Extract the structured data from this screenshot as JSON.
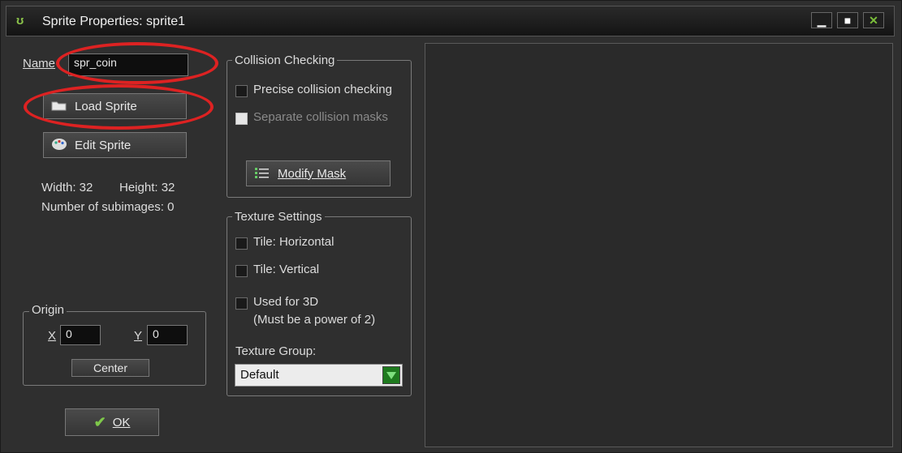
{
  "window": {
    "title": "Sprite Properties: sprite1",
    "app_icon_glyph": "ʊ"
  },
  "controls": {
    "minimize": "▁",
    "maximize": "■",
    "close": "✕"
  },
  "left": {
    "name_label": "Name",
    "name_value": "spr_coin",
    "load_sprite": "Load Sprite",
    "edit_sprite": "Edit Sprite",
    "width_text": "Width: 32",
    "height_text": "Height: 32",
    "subimages_text": "Number of subimages: 0",
    "origin_group": "Origin",
    "x_label": "X",
    "x_value": "0",
    "y_label": "Y",
    "y_value": "0",
    "center_button": "Center",
    "ok_button": "OK"
  },
  "collision": {
    "group": "Collision Checking",
    "precise": "Precise collision checking",
    "separate_masks": "Separate collision masks",
    "modify_mask": "Modify Mask"
  },
  "texture": {
    "group": "Texture Settings",
    "tile_h": "Tile: Horizontal",
    "tile_v": "Tile: Vertical",
    "used_3d_line1": "Used for 3D",
    "used_3d_line2": "(Must be a power of 2)",
    "group_label": "Texture Group:",
    "group_value": "Default"
  },
  "colors": {
    "annotation": "#d22222",
    "accent_green": "#1e7a1e"
  }
}
